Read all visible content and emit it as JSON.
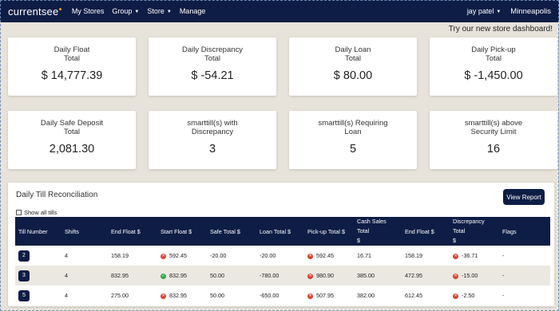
{
  "nav": {
    "brand": "currentsee",
    "items": [
      "My Stores",
      "Group",
      "Store",
      "Manage"
    ],
    "user": "jay patel",
    "city": "Minneapolis"
  },
  "promo": "Try our new store dashboard!",
  "cards": [
    {
      "title1": "Daily Float",
      "title2": "Total",
      "value": "$ 14,777.39"
    },
    {
      "title1": "Daily Discrepancy",
      "title2": "Total",
      "value": "$ -54.21"
    },
    {
      "title1": "Daily Loan",
      "title2": "Total",
      "value": "$ 80.00"
    },
    {
      "title1": "Daily Pick-up",
      "title2": "Total",
      "value": "$ -1,450.00"
    },
    {
      "title1": "Daily Safe Deposit",
      "title2": "Total",
      "value": "2,081.30"
    },
    {
      "title1": "smarttill(s) with",
      "title2": "Discrepancy",
      "value": "3"
    },
    {
      "title1": "smarttill(s) Requiring",
      "title2": "Loan",
      "value": "5"
    },
    {
      "title1": "smarttill(s) above",
      "title2": "Security Limit",
      "value": "16"
    }
  ],
  "reconciliation": {
    "title": "Daily Till Reconciliation",
    "view_report": "View Report",
    "show_all": "Show all tills",
    "headers": {
      "till": "Till Number",
      "shifts": "Shifts",
      "end_float": "End Float $",
      "start_float": "Start Float $",
      "safe_total": "Safe Total $",
      "loan_total": "Loan Total $",
      "pickup_total": "Pick-up Total $",
      "cash_sales_1": "Cash Sales Total",
      "cash_sales_2": "$",
      "end_float2": "End Float $",
      "discrepancy_1": "Discrepancy Total",
      "discrepancy_2": "$",
      "flags": "Flags"
    },
    "rows": [
      {
        "till": "2",
        "shifts": "4",
        "end_float": "158.19",
        "start_float": "592.45",
        "start_status": "bad",
        "safe_total": "-20.00",
        "loan_total": "-20.00",
        "pickup_total": "592.45",
        "pickup_status": "bad",
        "cash_sales": "16.71",
        "end_float2": "158.19",
        "discrepancy": "-36.71",
        "flags": "-"
      },
      {
        "till": "3",
        "shifts": "4",
        "end_float": "832.95",
        "start_float": "832.95",
        "start_status": "ok",
        "safe_total": "50.00",
        "loan_total": "-780.00",
        "pickup_total": "980.90",
        "pickup_status": "bad",
        "cash_sales": "385.00",
        "end_float2": "472.95",
        "discrepancy": "-15.00",
        "flags": "-"
      },
      {
        "till": "5",
        "shifts": "4",
        "end_float": "275.00",
        "start_float": "832.95",
        "start_status": "bad",
        "safe_total": "50.00",
        "loan_total": "-650.00",
        "pickup_total": "507.95",
        "pickup_status": "bad",
        "cash_sales": "382.00",
        "end_float2": "612.45",
        "discrepancy": "-2.50",
        "flags": "-"
      }
    ]
  },
  "colors": {
    "navy": "#0e1d45",
    "accent": "#f6a200",
    "error": "#d9432e",
    "success": "#3aa34a"
  }
}
